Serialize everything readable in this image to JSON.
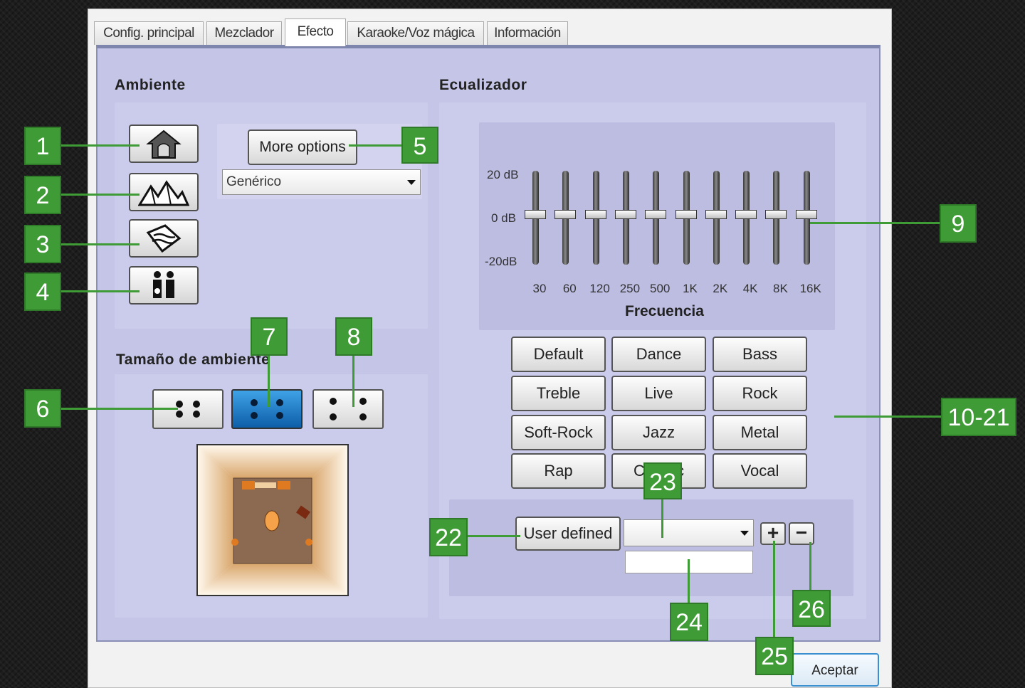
{
  "tabs": [
    {
      "label": "Config. principal"
    },
    {
      "label": "Mezclador"
    },
    {
      "label": "Efecto"
    },
    {
      "label": "Karaoke/Voz mágica"
    },
    {
      "label": "Información"
    }
  ],
  "active_tab": "Efecto",
  "ambiente": {
    "title": "Ambiente",
    "icons": [
      "house-icon",
      "mountains-icon",
      "water-icon",
      "people-icon"
    ],
    "more_options": "More options",
    "preset": "Genérico"
  },
  "tamano": {
    "title": "Tamaño de ambiente",
    "selected": "medium"
  },
  "ecualizador": {
    "title": "Ecualizador",
    "db_labels": {
      "top": "20 dB",
      "mid": "0 dB",
      "bottom": "-20dB"
    },
    "bands": [
      "30",
      "60",
      "120",
      "250",
      "500",
      "1K",
      "2K",
      "4K",
      "8K",
      "16K"
    ],
    "band_levels_db": [
      0,
      0,
      0,
      0,
      0,
      0,
      0,
      0,
      0,
      0
    ],
    "xlabel": "Frecuencia",
    "presets": [
      "Default",
      "Dance",
      "Bass",
      "Treble",
      "Live",
      "Rock",
      "Soft-Rock",
      "Jazz",
      "Metal",
      "Rap",
      "Classic",
      "Vocal"
    ],
    "user_defined": "User defined",
    "user_select_value": "",
    "user_name_value": ""
  },
  "footer": {
    "accept": "Aceptar"
  },
  "callouts": {
    "c1": "1",
    "c2": "2",
    "c3": "3",
    "c4": "4",
    "c5": "5",
    "c6": "6",
    "c7": "7",
    "c8": "8",
    "c9": "9",
    "c10": "10-21",
    "c22": "22",
    "c23": "23",
    "c24": "24",
    "c25": "25",
    "c26": "26"
  },
  "colors": {
    "accent_green": "#3f9b35",
    "panel": "#c5c5e7",
    "selected_button": "#1e7fcf"
  }
}
